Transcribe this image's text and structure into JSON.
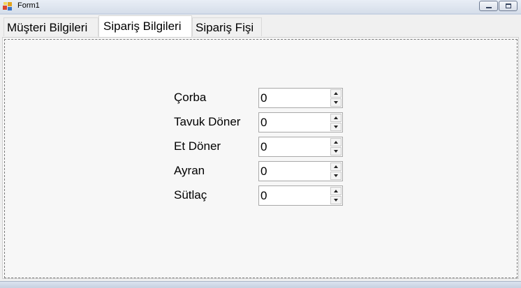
{
  "window": {
    "title": "Form1",
    "app_icon": "winforms-app-icon"
  },
  "controls": {
    "minimize_icon": "minimize-icon",
    "maximize_icon": "maximize-icon"
  },
  "tabs": [
    {
      "label": "Müşteri Bilgileri",
      "selected": false
    },
    {
      "label": "Sipariş Bilgileri",
      "selected": true
    },
    {
      "label": "Sipariş Fişi",
      "selected": false
    }
  ],
  "order_items": [
    {
      "label": "Çorba",
      "value": "0"
    },
    {
      "label": "Tavuk Döner",
      "value": "0"
    },
    {
      "label": "Et Döner",
      "value": "0"
    },
    {
      "label": "Ayran",
      "value": "0"
    },
    {
      "label": "Sütlaç",
      "value": "0"
    }
  ]
}
